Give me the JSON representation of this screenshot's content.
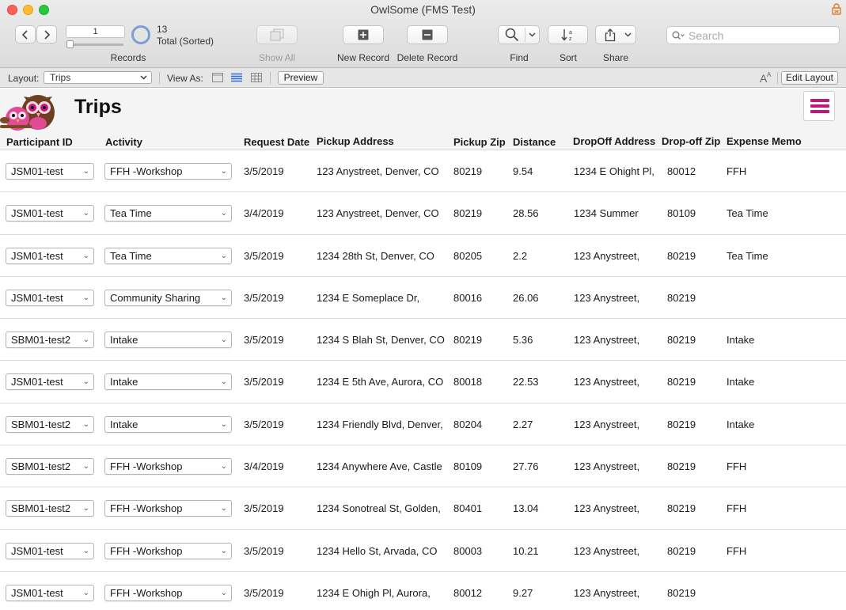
{
  "window": {
    "title": "OwlSome (FMS Test)"
  },
  "toolbar": {
    "record_number": "1",
    "found_count": "13",
    "found_desc": "Total (Sorted)",
    "records_label": "Records",
    "show_all_label": "Show All",
    "new_record_label": "New Record",
    "delete_record_label": "Delete Record",
    "find_label": "Find",
    "sort_label": "Sort",
    "share_label": "Share",
    "search_placeholder": "Search"
  },
  "layoutbar": {
    "layout_label": "Layout:",
    "layout_value": "Trips",
    "view_as_label": "View As:",
    "preview_label": "Preview",
    "edit_layout_label": "Edit Layout"
  },
  "header": {
    "title": "Trips",
    "columns": [
      "Participant ID",
      "Activity",
      "Request Date",
      "Pickup Address",
      "Pickup Zip",
      "Distance",
      "DropOff Address",
      "Drop-off Zip",
      "Expense Memo"
    ]
  },
  "colors": {
    "accent": "#c2177a",
    "ring": "#7a9fd0"
  },
  "rows": [
    {
      "participant": "JSM01-test",
      "activity": "FFH -Workshop",
      "date": "3/5/2019",
      "pickup": "123 Anystreet, Denver, CO",
      "pzip": "80219",
      "distance": "9.54",
      "dropoff": "1234 E Ohight Pl,",
      "dzip": "80012",
      "memo": "FFH"
    },
    {
      "participant": "JSM01-test",
      "activity": "Tea Time",
      "date": "3/4/2019",
      "pickup": "123 Anystreet, Denver, CO",
      "pzip": "80219",
      "distance": "28.56",
      "dropoff": "1234 Summer",
      "dzip": "80109",
      "memo": "Tea Time"
    },
    {
      "participant": "JSM01-test",
      "activity": "Tea Time",
      "date": "3/5/2019",
      "pickup": "1234 28th St, Denver, CO",
      "pzip": "80205",
      "distance": "2.2",
      "dropoff": "123 Anystreet,",
      "dzip": "80219",
      "memo": "Tea Time"
    },
    {
      "participant": "JSM01-test",
      "activity": "Community Sharing",
      "date": "3/5/2019",
      "pickup": "1234 E Someplace Dr,",
      "pzip": "80016",
      "distance": "26.06",
      "dropoff": "123 Anystreet,",
      "dzip": "80219",
      "memo": ""
    },
    {
      "participant": "SBM01-test2",
      "activity": "Intake",
      "date": "3/5/2019",
      "pickup": "1234 S Blah St, Denver, CO",
      "pzip": "80219",
      "distance": "5.36",
      "dropoff": "123 Anystreet,",
      "dzip": "80219",
      "memo": "Intake"
    },
    {
      "participant": "JSM01-test",
      "activity": "Intake",
      "date": "3/5/2019",
      "pickup": "1234 E 5th Ave, Aurora, CO",
      "pzip": "80018",
      "distance": "22.53",
      "dropoff": "123 Anystreet,",
      "dzip": "80219",
      "memo": "Intake"
    },
    {
      "participant": "SBM01-test2",
      "activity": "Intake",
      "date": "3/5/2019",
      "pickup": "1234 Friendly Blvd, Denver,",
      "pzip": "80204",
      "distance": "2.27",
      "dropoff": "123 Anystreet,",
      "dzip": "80219",
      "memo": "Intake"
    },
    {
      "participant": "SBM01-test2",
      "activity": "FFH -Workshop",
      "date": "3/4/2019",
      "pickup": "1234 Anywhere Ave, Castle",
      "pzip": "80109",
      "distance": "27.76",
      "dropoff": "123 Anystreet,",
      "dzip": "80219",
      "memo": "FFH"
    },
    {
      "participant": "SBM01-test2",
      "activity": "FFH -Workshop",
      "date": "3/5/2019",
      "pickup": "1234 Sonotreal St, Golden,",
      "pzip": "80401",
      "distance": "13.04",
      "dropoff": "123 Anystreet,",
      "dzip": "80219",
      "memo": "FFH"
    },
    {
      "participant": "JSM01-test",
      "activity": "FFH -Workshop",
      "date": "3/5/2019",
      "pickup": "1234 Hello St, Arvada, CO",
      "pzip": "80003",
      "distance": "10.21",
      "dropoff": "123 Anystreet,",
      "dzip": "80219",
      "memo": "FFH"
    },
    {
      "participant": "JSM01-test",
      "activity": "FFH -Workshop",
      "date": "3/5/2019",
      "pickup": "1234 E Ohigh Pl, Aurora,",
      "pzip": "80012",
      "distance": "9.27",
      "dropoff": "123 Anystreet,",
      "dzip": "80219",
      "memo": ""
    }
  ]
}
